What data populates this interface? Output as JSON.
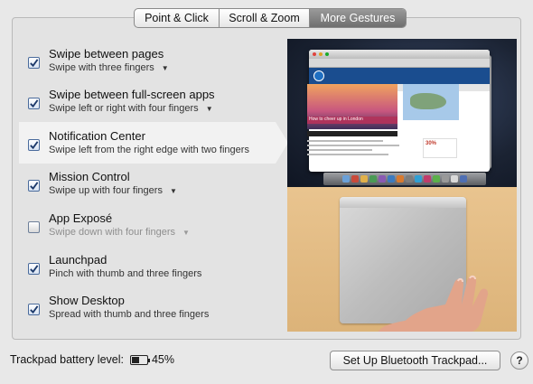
{
  "tabs": [
    {
      "label": "Point & Click",
      "active": false
    },
    {
      "label": "Scroll & Zoom",
      "active": false
    },
    {
      "label": "More Gestures",
      "active": true
    }
  ],
  "gestures": [
    {
      "title": "Swipe between pages",
      "subtitle": "Swipe with three fingers",
      "checked": true,
      "has_menu": true,
      "selected": false
    },
    {
      "title": "Swipe between full-screen apps",
      "subtitle": "Swipe left or right with four fingers",
      "checked": true,
      "has_menu": true,
      "selected": false
    },
    {
      "title": "Notification Center",
      "subtitle": "Swipe left from the right edge with two fingers",
      "checked": true,
      "has_menu": false,
      "selected": true
    },
    {
      "title": "Mission Control",
      "subtitle": "Swipe up with four fingers",
      "checked": true,
      "has_menu": true,
      "selected": false
    },
    {
      "title": "App Exposé",
      "subtitle": "Swipe down with four fingers",
      "checked": false,
      "has_menu": true,
      "selected": false
    },
    {
      "title": "Launchpad",
      "subtitle": "Pinch with thumb and three fingers",
      "checked": true,
      "has_menu": false,
      "selected": false
    },
    {
      "title": "Show Desktop",
      "subtitle": "Spread with thumb and three fingers",
      "checked": true,
      "has_menu": false,
      "selected": false
    }
  ],
  "preview": {
    "hero_caption": "How to cheer up in London",
    "promo_text": "30%"
  },
  "footer": {
    "battery_label": "Trackpad battery level:",
    "battery_percent": "45%",
    "battery_level": 0.45,
    "setup_button": "Set Up Bluetooth Trackpad...",
    "help_label": "?"
  },
  "icons": {
    "checkmark": "checkmark-icon",
    "menu": "chevron-down-icon",
    "battery": "battery-icon",
    "help": "help-icon"
  },
  "colors": {
    "active_tab": "#7f7f7f",
    "checkbox_check": "#1d3a6b",
    "selected_row": "#f2f2f2"
  }
}
